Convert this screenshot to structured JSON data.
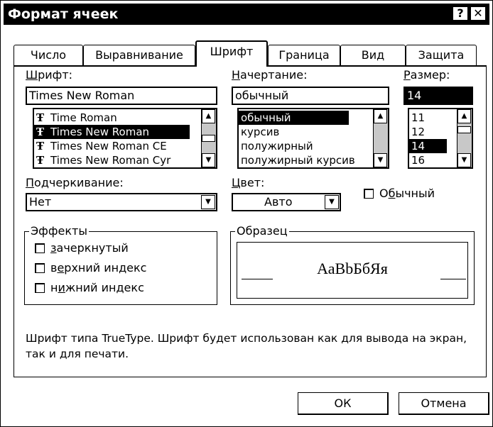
{
  "window": {
    "title": "Формат ячеек",
    "help_button": "?",
    "close_button": "✕"
  },
  "tabs": [
    {
      "label": "Число"
    },
    {
      "label": "Выравнивание"
    },
    {
      "label": "Шрифт"
    },
    {
      "label": "Граница"
    },
    {
      "label": "Вид"
    },
    {
      "label": "Защита"
    }
  ],
  "font": {
    "label": "Шрифт:",
    "value": "Times New Roman",
    "items": [
      "Time Roman",
      "Times New Roman",
      "Times New Roman CE",
      "Times New Roman Cyr"
    ],
    "selected_index": 1,
    "item_icon": "truetype-icon"
  },
  "style": {
    "label": "Начертание:",
    "value": "обычный",
    "items": [
      "обычный",
      "курсив",
      "полужирный",
      "полужирный курсив"
    ],
    "selected_index": 0
  },
  "size": {
    "label": "Размер:",
    "value": "14",
    "items": [
      "11",
      "12",
      "14",
      "16"
    ],
    "selected_index": 2
  },
  "underline": {
    "label": "Подчеркивание:",
    "value": "Нет"
  },
  "color": {
    "label": "Цвет:",
    "value": "Авто"
  },
  "normal_font": {
    "label": "Обычный",
    "checked": false
  },
  "effects": {
    "title": "Эффекты",
    "items": [
      {
        "label": "зачеркнутый",
        "checked": false
      },
      {
        "label": "верхний индекс",
        "checked": false
      },
      {
        "label": "нижний индекс",
        "checked": false
      }
    ]
  },
  "preview": {
    "title": "Образец",
    "sample": "АаBbБбЯя"
  },
  "info_text": "Шрифт типа TrueType. Шрифт будет использован как для вывода на экран, так и для печати.",
  "buttons": {
    "ok": "ОК",
    "cancel": "Отмена"
  }
}
